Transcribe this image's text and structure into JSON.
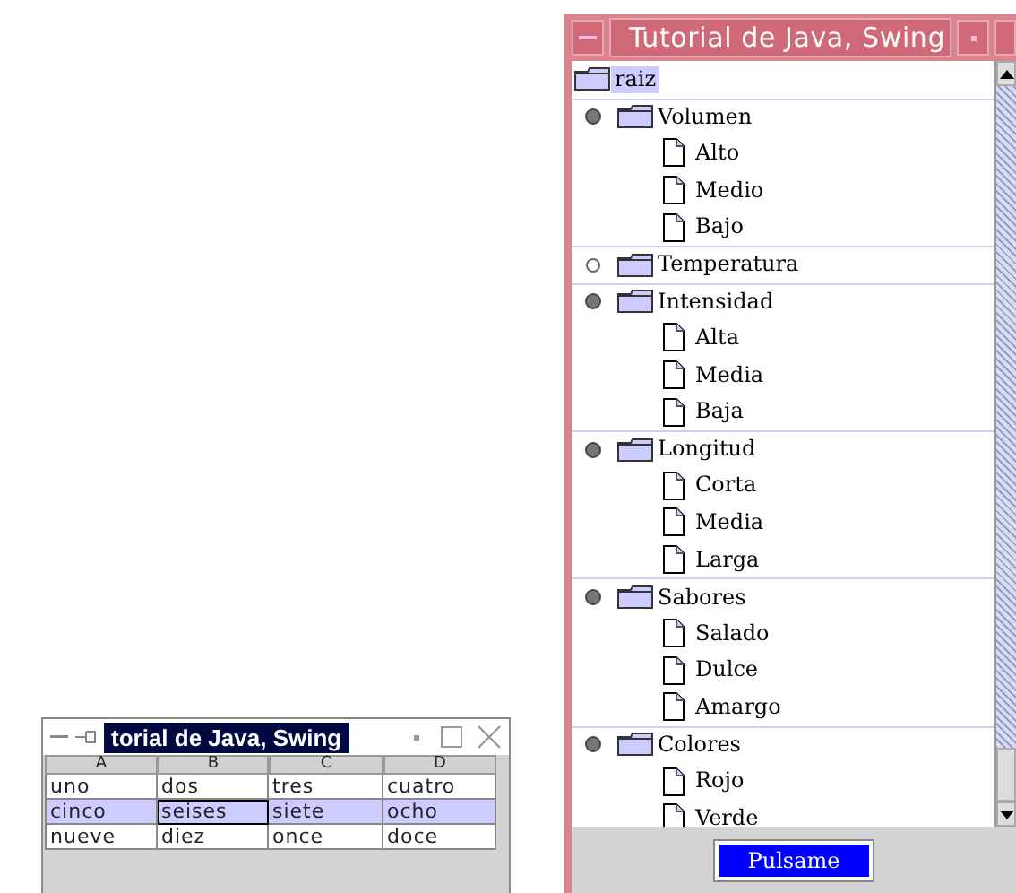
{
  "right_window": {
    "title": "Tutorial de Java, Swing",
    "tree": {
      "label": "raiz",
      "selected": true,
      "children": [
        {
          "label": "Volumen",
          "selected": false,
          "expanded": true,
          "children": [
            {
              "label": "Alto",
              "selected": false
            },
            {
              "label": "Medio",
              "selected": false
            },
            {
              "label": "Bajo",
              "selected": false
            }
          ]
        },
        {
          "label": "Temperatura",
          "selected": false,
          "expanded": false
        },
        {
          "label": "Intensidad",
          "selected": false,
          "expanded": true,
          "children": [
            {
              "label": "Alta",
              "selected": false
            },
            {
              "label": "Media",
              "selected": false
            },
            {
              "label": "Baja",
              "selected": false
            }
          ]
        },
        {
          "label": "Longitud",
          "selected": false,
          "expanded": true,
          "children": [
            {
              "label": "Corta",
              "selected": false
            },
            {
              "label": "Media",
              "selected": false
            },
            {
              "label": "Larga",
              "selected": false
            }
          ]
        },
        {
          "label": "Sabores",
          "selected": false,
          "expanded": true,
          "children": [
            {
              "label": "Salado",
              "selected": false
            },
            {
              "label": "Dulce",
              "selected": false
            },
            {
              "label": "Amargo",
              "selected": false
            }
          ]
        },
        {
          "label": "Colores",
          "selected": false,
          "expanded": true,
          "children": [
            {
              "label": "Rojo",
              "selected": false
            },
            {
              "label": "Verde",
              "selected": false
            }
          ]
        }
      ]
    },
    "button": "Pulsame"
  },
  "left_window": {
    "title": "torial de Java, Swing",
    "table": {
      "columns": [
        "A",
        "B",
        "C",
        "D"
      ],
      "rows": [
        {
          "selected": false,
          "cells": [
            {
              "text": "uno",
              "focused": false
            },
            {
              "text": "dos",
              "focused": false
            },
            {
              "text": "tres",
              "focused": false
            },
            {
              "text": "cuatro",
              "focused": false
            }
          ]
        },
        {
          "selected": true,
          "cells": [
            {
              "text": "cinco",
              "focused": false
            },
            {
              "text": "seises",
              "focused": true
            },
            {
              "text": "siete",
              "focused": false
            },
            {
              "text": "ocho",
              "focused": false
            }
          ]
        },
        {
          "selected": false,
          "cells": [
            {
              "text": "nueve",
              "focused": false
            },
            {
              "text": "diez",
              "focused": false
            },
            {
              "text": "once",
              "focused": false
            },
            {
              "text": "doce",
              "focused": false
            }
          ]
        }
      ]
    }
  }
}
